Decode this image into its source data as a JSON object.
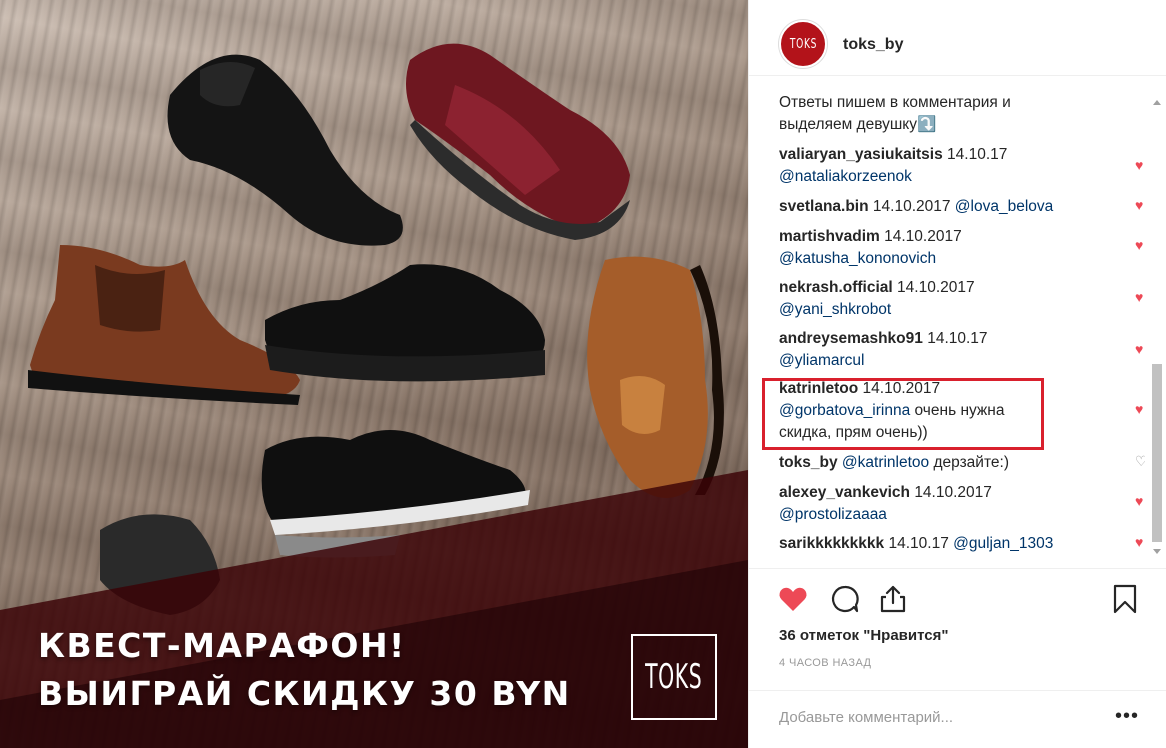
{
  "promo": {
    "line1": "КВЕСТ-МАРАФОН!",
    "line2": "ВЫИГРАЙ СКИДКУ 30 BYN",
    "logo_text": "TOKS"
  },
  "header": {
    "avatar_text": "TOKS",
    "username": "toks_by"
  },
  "caption": {
    "line1": "Ответы пишем в комментария и",
    "line2": "выделяем девушку⤵️"
  },
  "comments": [
    {
      "user": "valiaryan_yasiukaitsis",
      "time": "14.10.17",
      "mention": "@nataliakorzeenok",
      "text": "",
      "liked": true
    },
    {
      "user": "svetlana.bin",
      "time": "14.10.2017",
      "mention": "@lova_belova",
      "text": "",
      "liked": true
    },
    {
      "user": "martishvadim",
      "time": "14.10.2017",
      "mention": "@katusha_kononovich",
      "text": "",
      "liked": true
    },
    {
      "user": "nekrash.official",
      "time": "14.10.2017",
      "mention": "@yani_shkrobot",
      "text": "",
      "liked": true
    },
    {
      "user": "andreysemashko91",
      "time": "14.10.17",
      "mention": "@yliamarcul",
      "text": "",
      "liked": true
    },
    {
      "user": "katrinletoo",
      "time": "14.10.2017",
      "mention": "@gorbatova_irinna",
      "text": "очень нужна",
      "text2": "скидка, прям очень))",
      "liked": true
    },
    {
      "user": "toks_by",
      "time": "",
      "mention": "@katrinletoo",
      "text": "дерзайте:)",
      "liked": false
    },
    {
      "user": "alexey_vankevich",
      "time": "14.10.2017",
      "mention": "@prostolizaaaa",
      "text": "",
      "liked": true
    },
    {
      "user": "sarikkkkkkkkk",
      "time": "14.10.17",
      "mention": "@guljan_1303",
      "text": "",
      "liked": true
    }
  ],
  "icons": {
    "heart_filled": "♥",
    "heart_empty": "♡"
  },
  "likes_text": "36 отметок \"Нравится\"",
  "time_ago": "4 ЧАСОВ НАЗАД",
  "add_comment_placeholder": "Добавьте комментарий...",
  "more_label": "•••",
  "colors": {
    "like_red": "#ed4956",
    "mention_blue": "#003569",
    "brand_red": "#b3131a",
    "highlight_red": "#d9202d"
  }
}
